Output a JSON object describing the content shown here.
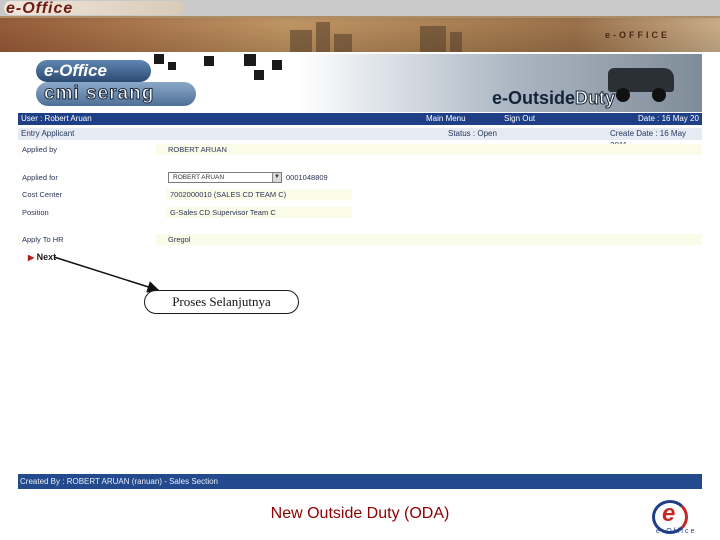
{
  "banner": {
    "logo_text": "e-Office",
    "right_text": "e-OFFICE"
  },
  "header": {
    "logo_line1": "e-Office",
    "logo_line2": "cmi serang",
    "module_title_a": "e-Outside",
    "module_title_b": "Duty"
  },
  "nav": {
    "user_label": "User : Robert Aruan",
    "main_menu": "Main Menu",
    "sign_out": "Sign Out",
    "date_label": "Date : 16 May 20"
  },
  "subbar": {
    "entry_label": "Entry Applicant",
    "status_label": "Status : Open",
    "create_date_label": "Create Date : 16 May 2011"
  },
  "form": {
    "applied_by_label": "Applied by",
    "applied_by_value": "ROBERT ARUAN",
    "applied_for_label": "Applied for",
    "applied_for_value": "ROBERT ARUAN",
    "applied_for_nik": "0001048809",
    "cost_center_label": "Cost Center",
    "cost_center_value": "7002000010 (SALES CD TEAM C)",
    "position_label": "Position",
    "position_value": "G-Sales CD Supervisor Team C",
    "apply_to_hr_label": "Apply To HR",
    "apply_to_hr_value": "Gregol"
  },
  "actions": {
    "next_label": "Next"
  },
  "annotation": {
    "callout_text": "Proses Selanjutnya"
  },
  "footer": {
    "created_by": "Created By : ROBERT ARUAN (ranuan) - Sales Section",
    "slide_title": "New Outside Duty (ODA)",
    "corner_logo_text": "e-Office"
  }
}
